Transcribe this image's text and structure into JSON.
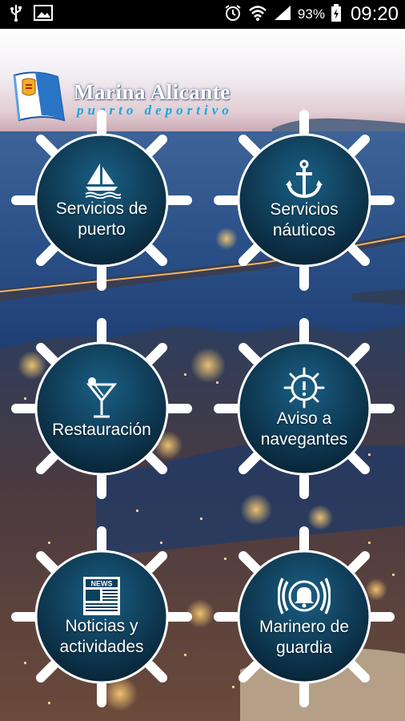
{
  "status_bar": {
    "battery": "93%",
    "time": "09:20",
    "icons": [
      "usb-icon",
      "image-icon",
      "alarm-icon",
      "wifi-icon",
      "signal-icon",
      "battery-icon"
    ]
  },
  "header": {
    "title": "Marina Alicante",
    "subtitle": "puerto deportivo"
  },
  "menu": [
    {
      "label": "Servicios de\npuerto",
      "icon": "sailboat-icon"
    },
    {
      "label": "Servicios\nnáuticos",
      "icon": "anchor-icon"
    },
    {
      "label": "Restauración",
      "icon": "cocktail-icon"
    },
    {
      "label": "Aviso a\nnavegantes",
      "icon": "warning-helm-icon"
    },
    {
      "label": "Noticias y\nactividades",
      "icon": "newspaper-icon",
      "icon_text": "NEWS"
    },
    {
      "label": "Marinero de\nguardia",
      "icon": "alarm-bell-icon"
    }
  ],
  "colors": {
    "wheel_center": "#0d3f5e",
    "spoke": "#ffffff",
    "subtitle": "#19a6de"
  }
}
